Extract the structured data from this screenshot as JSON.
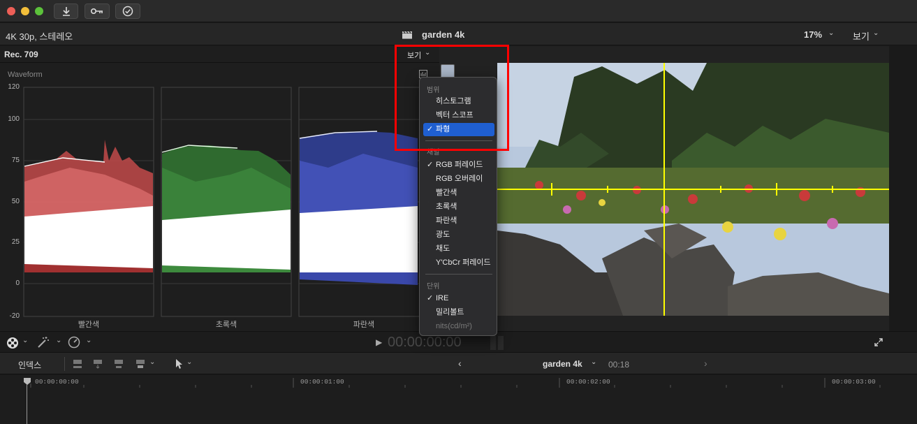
{
  "titlebar": {
    "buttons": [
      {
        "icon": "import-arrow-icon"
      },
      {
        "icon": "key-icon"
      },
      {
        "icon": "checkmark-circle-icon"
      }
    ]
  },
  "viewer_header": {
    "format": "4K 30p, 스테레오",
    "clip_title": "garden 4k",
    "zoom": "17%",
    "view_label": "보기"
  },
  "scope": {
    "color_space": "Rec. 709",
    "view_button": "보기",
    "scope_name": "Waveform",
    "y_ticks": [
      "120",
      "100",
      "75",
      "50",
      "25",
      "0",
      "-20"
    ],
    "channels": [
      "빨간색",
      "초록색",
      "파란색"
    ]
  },
  "menu": {
    "section_range": "범위",
    "range_items": [
      {
        "label": "히스토그램",
        "checked": false
      },
      {
        "label": "벡터 스코프",
        "checked": false
      },
      {
        "label": "파형",
        "checked": true,
        "selected": true
      }
    ],
    "section_channel": "채널",
    "channel_items": [
      {
        "label": "RGB 퍼레이드",
        "checked": true
      },
      {
        "label": "RGB 오버레이",
        "checked": false
      },
      {
        "label": "빨간색",
        "checked": false
      },
      {
        "label": "초록색",
        "checked": false
      },
      {
        "label": "파란색",
        "checked": false
      },
      {
        "label": "광도",
        "checked": false
      },
      {
        "label": "채도",
        "checked": false
      },
      {
        "label": "Y'CbCr 퍼레이드",
        "checked": false
      }
    ],
    "section_unit": "단위",
    "unit_items": [
      {
        "label": "IRE",
        "checked": true
      },
      {
        "label": "밀리볼트",
        "checked": false
      },
      {
        "label": "nits(cd/m²)",
        "checked": false,
        "disabled": true
      }
    ],
    "check_glyph": "✓"
  },
  "controls": {
    "timecode": "00:00:00:00"
  },
  "timeline": {
    "index_label": "인덱스",
    "project_name": "garden 4k",
    "duration": "00:18",
    "ruler": [
      "00:00:00:00",
      "00:00:01:00",
      "00:00:02:00",
      "00:00:03:00"
    ]
  },
  "colors": {
    "accent": "#1f5fd1",
    "highlight": "#ff0000",
    "crosshair": "#ffff00"
  }
}
